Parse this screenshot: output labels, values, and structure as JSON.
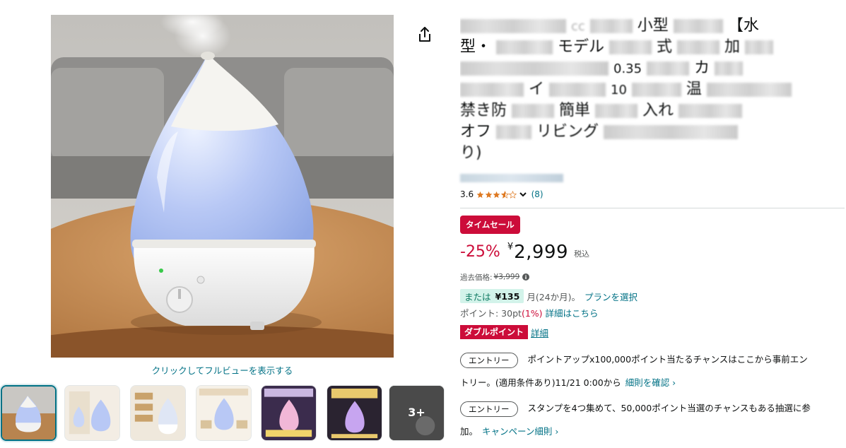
{
  "gallery": {
    "fullview_link": "クリックしてフルビューを表示する",
    "more_thumbs_label": "3+"
  },
  "icons": {
    "share": "share-icon",
    "star": "star-icon",
    "chevron": "chevron-down-icon",
    "info": "info-icon"
  },
  "product": {
    "title_visible_fragments": [
      "小型",
      "【水",
      "型・",
      "モデル",
      "式",
      "加",
      "cc",
      "0.35",
      "カ",
      "イ",
      "10",
      "温",
      "禁き防",
      "簡単",
      "入れ",
      "オフ",
      "リビング",
      "り)"
    ]
  },
  "rating": {
    "value": "3.6",
    "stars": 3.6,
    "count": "(8)"
  },
  "deal": {
    "badge": "タイムセール"
  },
  "price": {
    "discount": "-25%",
    "currency": "¥",
    "amount": "2,999",
    "tax_note": "税込",
    "past_label": "過去価格:",
    "past_price": "¥3,999"
  },
  "installment": {
    "label": "または",
    "amount": "¥135",
    "term": "月(24か月)。",
    "plan_link": "プランを選択"
  },
  "points": {
    "label": "ポイント: 30pt",
    "percent": "(1%)",
    "details_link": "詳細はこちら"
  },
  "double_point": {
    "badge": "ダブルポイント",
    "link": "詳細"
  },
  "entries": [
    {
      "button": "エントリー",
      "line1": "ポイントアップx100,000ポイント当たるチャンスはここから事前エン",
      "line2": "トリー。(適用条件あり)11/21 0:00から",
      "link": "細則を確認 ›"
    },
    {
      "button": "エントリー",
      "line1": "スタンプを4つ集めて、50,000ポイント当選のチャンスもある抽選に参",
      "line2": "加。",
      "link": "キャンペーン細則 ›"
    }
  ],
  "colors": {
    "deal_red": "#cc0c39",
    "link_teal": "#007185",
    "install_green_bg": "#d3f3ea",
    "star_orange": "#de7921"
  }
}
